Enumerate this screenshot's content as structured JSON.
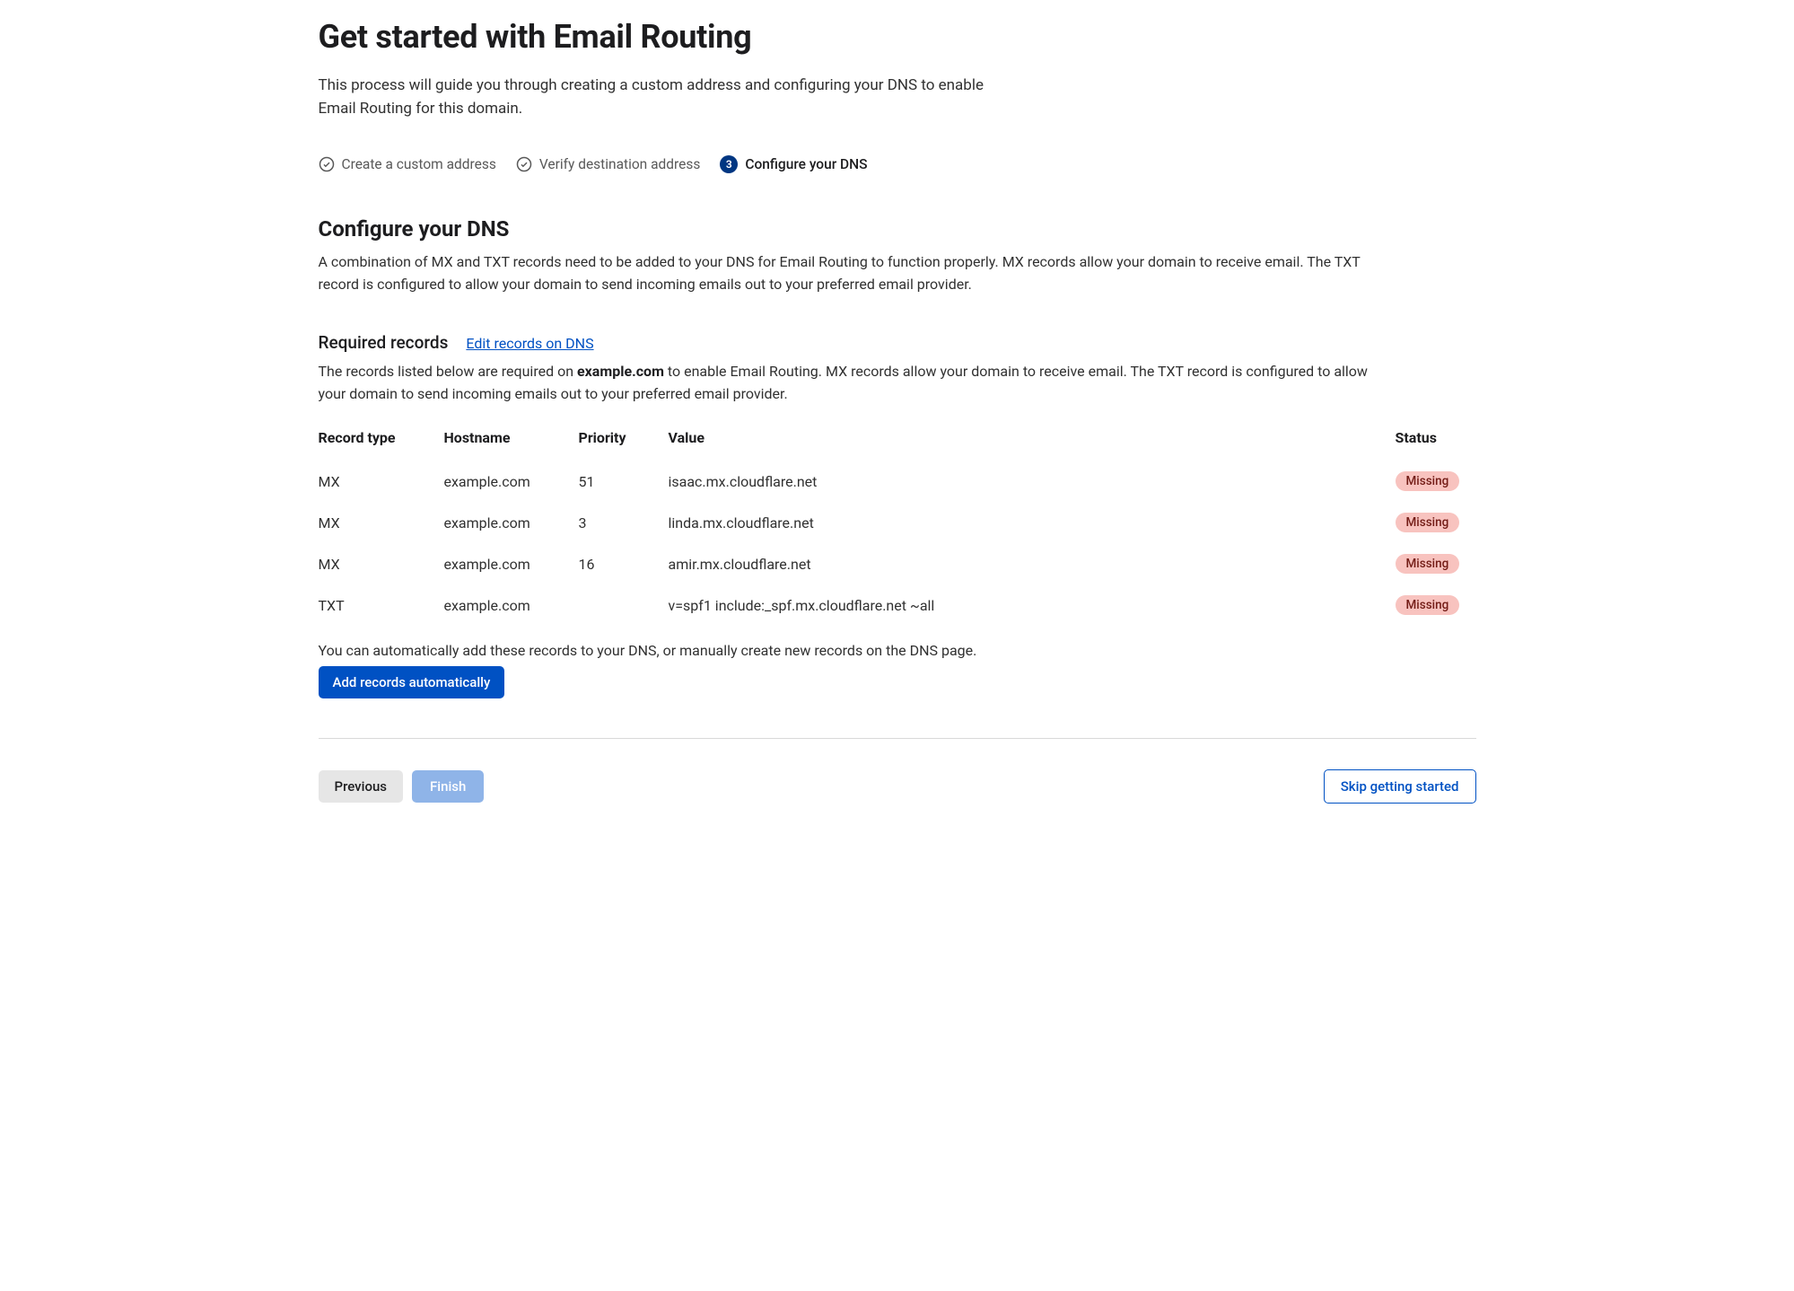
{
  "page_title": "Get started with Email Routing",
  "intro": "This process will guide you through creating a custom address and configuring your DNS to enable Email Routing for this domain.",
  "steps": [
    {
      "label": "Create a custom address",
      "state": "done"
    },
    {
      "label": "Verify destination address",
      "state": "done"
    },
    {
      "label": "Configure your DNS",
      "state": "current",
      "number": "3"
    }
  ],
  "section": {
    "title": "Configure your DNS",
    "desc": "A combination of MX and TXT records need to be added to your DNS for Email Routing to function properly. MX records allow your domain to receive email. The TXT record is configured to allow your domain to send incoming emails out to your preferred email provider."
  },
  "required": {
    "heading": "Required records",
    "edit_link": "Edit records on DNS",
    "domain": "example.com",
    "desc_prefix": "The records listed below are required on ",
    "desc_suffix": " to enable Email Routing. MX records allow your domain to receive email. The TXT record is configured to allow your domain to send incoming emails out to your preferred email provider."
  },
  "table": {
    "headers": {
      "type": "Record type",
      "hostname": "Hostname",
      "priority": "Priority",
      "value": "Value",
      "status": "Status"
    },
    "rows": [
      {
        "type": "MX",
        "hostname": "example.com",
        "priority": "51",
        "value": "isaac.mx.cloudflare.net",
        "status": "Missing"
      },
      {
        "type": "MX",
        "hostname": "example.com",
        "priority": "3",
        "value": "linda.mx.cloudflare.net",
        "status": "Missing"
      },
      {
        "type": "MX",
        "hostname": "example.com",
        "priority": "16",
        "value": "amir.mx.cloudflare.net",
        "status": "Missing"
      },
      {
        "type": "TXT",
        "hostname": "example.com",
        "priority": "",
        "value": "v=spf1 include:_spf.mx.cloudflare.net ~all",
        "status": "Missing"
      }
    ]
  },
  "auto": {
    "note": "You can automatically add these records to your DNS, or manually create new records on the DNS page.",
    "button": "Add records automatically"
  },
  "footer": {
    "previous": "Previous",
    "finish": "Finish",
    "skip": "Skip getting started"
  }
}
